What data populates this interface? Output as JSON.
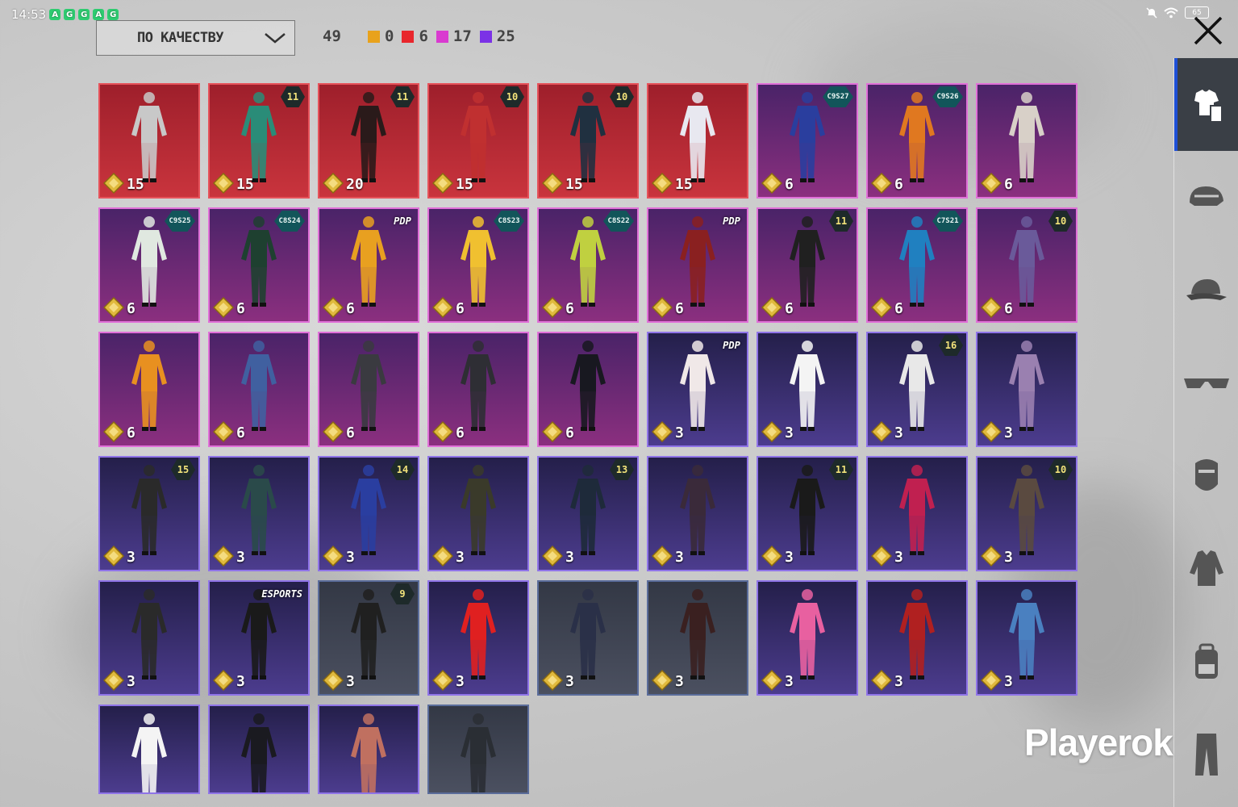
{
  "status_bar": {
    "time": "14:53",
    "notification_icons": [
      "A",
      "G",
      "G",
      "A",
      "G"
    ],
    "battery": "65"
  },
  "sort": {
    "label": "ПО КАЧЕСТВУ"
  },
  "total_count": "49",
  "rarity_counts": [
    {
      "color": "#e8a21c",
      "count": "0"
    },
    {
      "color": "#e8262c",
      "count": "6"
    },
    {
      "color": "#d93ad0",
      "count": "17"
    },
    {
      "color": "#7b32e6",
      "count": "25"
    }
  ],
  "sidebar": {
    "tabs": [
      "outfit-icon",
      "helmet-icon",
      "cap-icon",
      "glasses-icon",
      "mask-icon",
      "jacket-icon",
      "backpack-icon",
      "pants-icon"
    ]
  },
  "items": [
    {
      "rarity": "legendary",
      "qty": "15",
      "badge": "",
      "outfit_color": "#c8c8c8"
    },
    {
      "rarity": "legendary",
      "qty": "15",
      "badge": "11",
      "outfit_color": "#2a8c78"
    },
    {
      "rarity": "legendary",
      "qty": "20",
      "badge": "11",
      "outfit_color": "#2a1a1a"
    },
    {
      "rarity": "legendary",
      "qty": "15",
      "badge": "10",
      "outfit_color": "#c03030"
    },
    {
      "rarity": "legendary",
      "qty": "15",
      "badge": "10",
      "outfit_color": "#203040"
    },
    {
      "rarity": "legendary",
      "qty": "15",
      "badge": "",
      "outfit_color": "#e8e8f0"
    },
    {
      "rarity": "epic",
      "qty": "6",
      "badge": "C9S27",
      "outfit_color": "#2a3e9e"
    },
    {
      "rarity": "epic",
      "qty": "6",
      "badge": "C9S26",
      "outfit_color": "#e07820"
    },
    {
      "rarity": "epic",
      "qty": "6",
      "badge": "",
      "outfit_color": "#d8d0c8"
    },
    {
      "rarity": "epic",
      "qty": "6",
      "badge": "C9S25",
      "outfit_color": "#e0e8e0"
    },
    {
      "rarity": "epic",
      "qty": "6",
      "badge": "C8S24",
      "outfit_color": "#1e4030"
    },
    {
      "rarity": "epic",
      "qty": "6",
      "badge": "PDP",
      "outfit_color": "#e8a020"
    },
    {
      "rarity": "epic",
      "qty": "6",
      "badge": "C8S23",
      "outfit_color": "#f0c030"
    },
    {
      "rarity": "epic",
      "qty": "6",
      "badge": "C8S22",
      "outfit_color": "#c0d040"
    },
    {
      "rarity": "epic",
      "qty": "6",
      "badge": "PDP",
      "outfit_color": "#8a2020"
    },
    {
      "rarity": "epic",
      "qty": "6",
      "badge": "11",
      "outfit_color": "#202020"
    },
    {
      "rarity": "epic",
      "qty": "6",
      "badge": "C7S21",
      "outfit_color": "#2080c0"
    },
    {
      "rarity": "epic",
      "qty": "6",
      "badge": "10",
      "outfit_color": "#6a5a9a"
    },
    {
      "rarity": "epic",
      "qty": "6",
      "badge": "",
      "outfit_color": "#e89020"
    },
    {
      "rarity": "epic",
      "qty": "6",
      "badge": "",
      "outfit_color": "#4060a0"
    },
    {
      "rarity": "epic",
      "qty": "6",
      "badge": "",
      "outfit_color": "#3a3a40"
    },
    {
      "rarity": "epic",
      "qty": "6",
      "badge": "",
      "outfit_color": "#2e2e34"
    },
    {
      "rarity": "epic",
      "qty": "6",
      "badge": "",
      "outfit_color": "#181820"
    },
    {
      "rarity": "rare",
      "qty": "3",
      "badge": "PDP",
      "outfit_color": "#f0e8e8"
    },
    {
      "rarity": "rare",
      "qty": "3",
      "badge": "",
      "outfit_color": "#f4f4f4"
    },
    {
      "rarity": "rare",
      "qty": "3",
      "badge": "16",
      "outfit_color": "#e8e8e8"
    },
    {
      "rarity": "rare",
      "qty": "3",
      "badge": "",
      "outfit_color": "#9a80b0"
    },
    {
      "rarity": "rare",
      "qty": "3",
      "badge": "15",
      "outfit_color": "#2a2a2a"
    },
    {
      "rarity": "rare",
      "qty": "3",
      "badge": "",
      "outfit_color": "#2a4a4a"
    },
    {
      "rarity": "rare",
      "qty": "3",
      "badge": "14",
      "outfit_color": "#2a3ea0"
    },
    {
      "rarity": "rare",
      "qty": "3",
      "badge": "",
      "outfit_color": "#3a3a2a"
    },
    {
      "rarity": "rare",
      "qty": "3",
      "badge": "13",
      "outfit_color": "#1e2a3a"
    },
    {
      "rarity": "rare",
      "qty": "3",
      "badge": "",
      "outfit_color": "#3a2a3a"
    },
    {
      "rarity": "rare",
      "qty": "3",
      "badge": "11",
      "outfit_color": "#1a1a1a"
    },
    {
      "rarity": "rare",
      "qty": "3",
      "badge": "",
      "outfit_color": "#c02050"
    },
    {
      "rarity": "rare",
      "qty": "3",
      "badge": "10",
      "outfit_color": "#5a4a40"
    },
    {
      "rarity": "rare",
      "qty": "3",
      "badge": "",
      "outfit_color": "#2a2a2a"
    },
    {
      "rarity": "rare",
      "qty": "3",
      "badge": "ESPORTS",
      "outfit_color": "#1a1a1a"
    },
    {
      "rarity": "basic",
      "qty": "3",
      "badge": "9",
      "outfit_color": "#202020"
    },
    {
      "rarity": "rare",
      "qty": "3",
      "badge": "",
      "outfit_color": "#e02020"
    },
    {
      "rarity": "basic",
      "qty": "3",
      "badge": "",
      "outfit_color": "#2a3048"
    },
    {
      "rarity": "basic",
      "qty": "3",
      "badge": "",
      "outfit_color": "#3a2020"
    },
    {
      "rarity": "rare",
      "qty": "3",
      "badge": "",
      "outfit_color": "#e860a0"
    },
    {
      "rarity": "rare",
      "qty": "3",
      "badge": "",
      "outfit_color": "#b02020"
    },
    {
      "rarity": "rare",
      "qty": "3",
      "badge": "",
      "outfit_color": "#4a80c0"
    },
    {
      "rarity": "rare",
      "qty": "",
      "badge": "",
      "outfit_color": "#f4f4f4"
    },
    {
      "rarity": "rare",
      "qty": "",
      "badge": "",
      "outfit_color": "#1a1a20"
    },
    {
      "rarity": "rare",
      "qty": "",
      "badge": "",
      "outfit_color": "#c07060"
    },
    {
      "rarity": "basic",
      "qty": "",
      "badge": "",
      "outfit_color": "#2a2e34"
    }
  ],
  "watermark": "Playerok"
}
